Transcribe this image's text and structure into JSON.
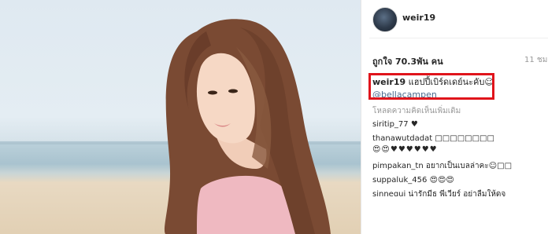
{
  "post": {
    "username": "weir19",
    "likes": "ถูกใจ 70.3พัน คน",
    "time": "11 ชม.",
    "caption_text": "แฮปปี้เบิร์ดเดย์นะคับ☺",
    "caption_mention": "@bellacampen",
    "load_more": "โหลดความคิดเห็นเพิ่มเติม"
  },
  "comments": [
    {
      "user": "siritip_77",
      "text": "♥"
    },
    {
      "user": "thanawutdadat",
      "text": "□□□□□□□□",
      "text2": "😍😍♥♥♥♥♥♥"
    },
    {
      "user": "pimpakan_tn",
      "text": "อยากเป็นเบลล่าคะ☺□□"
    },
    {
      "user": "suppaluk_456",
      "text": "😍😍😍"
    },
    {
      "user": "sinnegui",
      "text": "น่ารักมีธ พี่เวียร์ อย่าลืมให้ดูจ"
    }
  ],
  "colors": {
    "highlight": "#e0141b",
    "mention": "#4a6a8e",
    "muted": "#999999"
  }
}
